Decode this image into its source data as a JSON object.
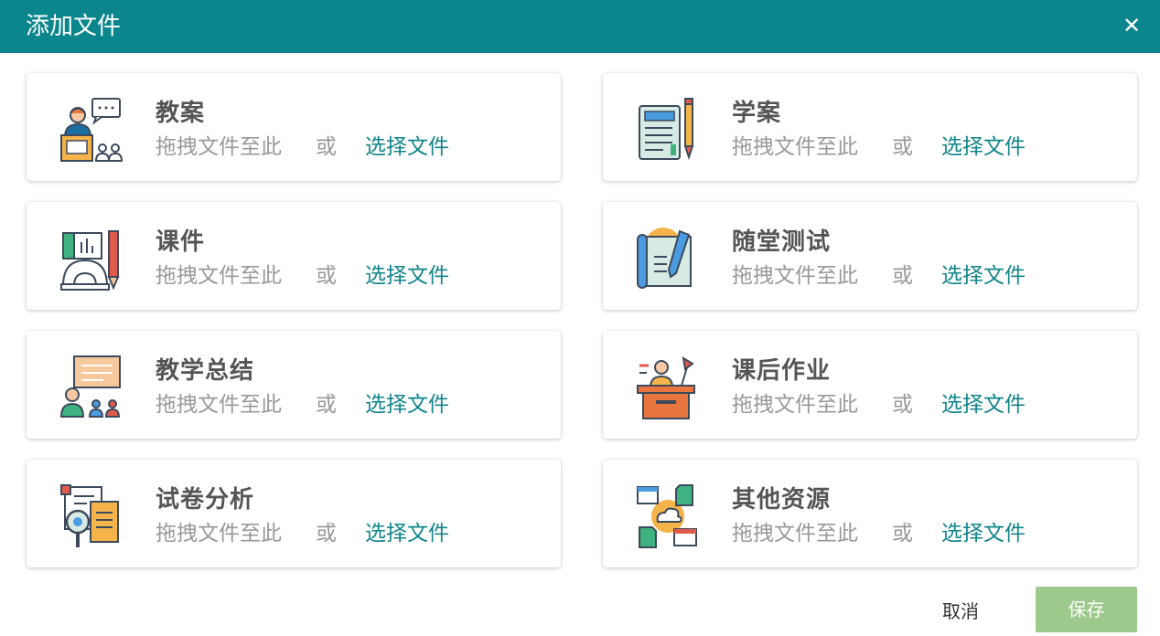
{
  "dialog": {
    "title": "添加文件",
    "close_symbol": "✕"
  },
  "common": {
    "drop_hint": "拖拽文件至此",
    "or": "或",
    "choose": "选择文件"
  },
  "cards": [
    {
      "label": "教案",
      "icon": "teacher-presentation-icon"
    },
    {
      "label": "学案",
      "icon": "notebook-pen-icon"
    },
    {
      "label": "课件",
      "icon": "courseware-tools-icon"
    },
    {
      "label": "随堂测试",
      "icon": "quiz-paper-pencil-icon"
    },
    {
      "label": "教学总结",
      "icon": "teaching-summary-board-icon"
    },
    {
      "label": "课后作业",
      "icon": "homework-desk-icon"
    },
    {
      "label": "试卷分析",
      "icon": "exam-analysis-magnifier-icon"
    },
    {
      "label": "其他资源",
      "icon": "cloud-resources-icon"
    }
  ],
  "footer": {
    "cancel": "取消",
    "save": "保存"
  },
  "colors": {
    "header": "#0c868d",
    "link": "#11858b",
    "save_button": "#9dc98c"
  }
}
